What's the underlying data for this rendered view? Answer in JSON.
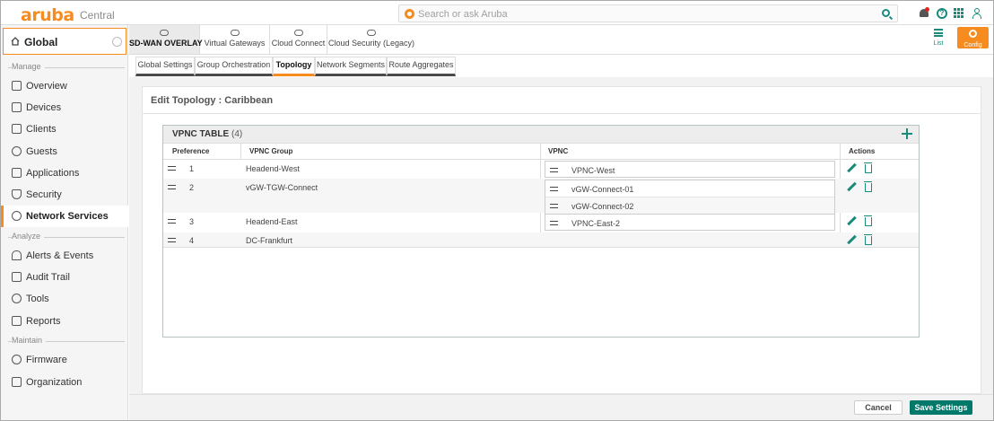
{
  "app": {
    "logo": "aruba",
    "product": "Central"
  },
  "search": {
    "placeholder": "Search or ask Aruba"
  },
  "sidebar": {
    "scope": "Global",
    "sections": [
      "Manage",
      "Analyze",
      "Maintain"
    ],
    "items": [
      {
        "label": "Overview",
        "icon": "overview-icon"
      },
      {
        "label": "Devices",
        "icon": "devices-icon"
      },
      {
        "label": "Clients",
        "icon": "clients-icon"
      },
      {
        "label": "Guests",
        "icon": "guests-icon"
      },
      {
        "label": "Applications",
        "icon": "applications-icon"
      },
      {
        "label": "Security",
        "icon": "security-icon"
      },
      {
        "label": "Network Services",
        "icon": "network-services-icon",
        "active": true
      },
      {
        "label": "Alerts & Events",
        "icon": "bell-icon"
      },
      {
        "label": "Audit Trail",
        "icon": "audit-icon"
      },
      {
        "label": "Tools",
        "icon": "tools-icon"
      },
      {
        "label": "Reports",
        "icon": "reports-icon"
      },
      {
        "label": "Firmware",
        "icon": "firmware-icon"
      },
      {
        "label": "Organization",
        "icon": "organization-icon"
      }
    ]
  },
  "top_tabs": [
    "SD-WAN OVERLAY",
    "Virtual Gateways",
    "Cloud Connect",
    "Cloud Security (Legacy)"
  ],
  "view_toggle": {
    "list_label": "List",
    "config_label": "Config"
  },
  "sub_tabs": [
    "Global Settings",
    "Group Orchestration",
    "Topology",
    "Network Segments",
    "Route Aggregates"
  ],
  "panel": {
    "title": "Edit Topology : Caribbean"
  },
  "vpnc_table": {
    "title": "VPNC TABLE",
    "count": "(4)",
    "columns": [
      "Preference",
      "VPNC Group",
      "VPNC",
      "Actions"
    ],
    "rows": [
      {
        "preference": "1",
        "group": "Headend-West",
        "vpnc": [
          "VPNC-West"
        ]
      },
      {
        "preference": "2",
        "group": "vGW-TGW-Connect",
        "vpnc": [
          "vGW-Connect-01",
          "vGW-Connect-02"
        ]
      },
      {
        "preference": "3",
        "group": "Headend-East",
        "vpnc": [
          "VPNC-East-2"
        ]
      },
      {
        "preference": "4",
        "group": "DC-Frankfurt",
        "vpnc": []
      }
    ]
  },
  "footer": {
    "cancel_label": "Cancel",
    "save_label": "Save Settings"
  },
  "colors": {
    "brand": "#f68b1f",
    "accent": "#1a8a7a",
    "primary_button": "#00796b"
  }
}
